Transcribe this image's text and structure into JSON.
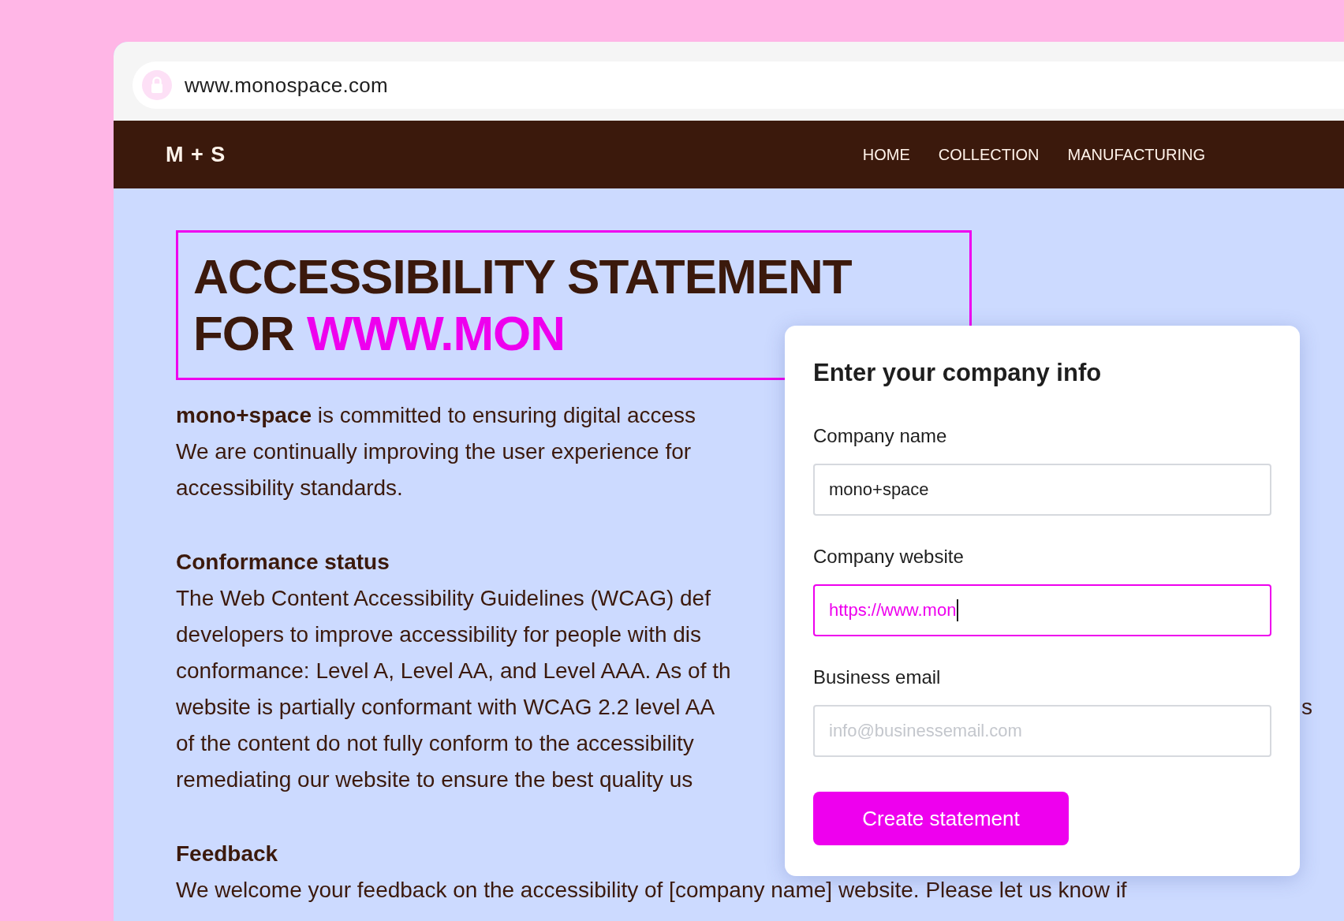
{
  "browser": {
    "url": "www.monospace.com"
  },
  "nav": {
    "logo": "M + S",
    "items": [
      {
        "label": "HOME"
      },
      {
        "label": "COLLECTION"
      },
      {
        "label": "MANUFACTURING"
      }
    ]
  },
  "heading": {
    "line_1": "ACCESSIBILITY STATEMENT",
    "line_2_prefix": "FOR",
    "line_2_highlight": "WWW.MON"
  },
  "intro": {
    "lines": [
      "**mono+space** is committed to ensuring digital access",
      "We are continually improving the user experience for",
      "accessibility standards."
    ]
  },
  "sections": [
    {
      "title": "Conformance status",
      "lines": [
        {
          "text": "The Web Content Accessibility Guidelines (WCAG) def"
        },
        {
          "text": "developers to improve accessibility for people with dis"
        },
        {
          "text": "conformance: Level A, Level AA, and Level AAA. As of th"
        },
        {
          "text": "website is partially conformant with WCAG 2.2 level AA",
          "tail": "s"
        },
        {
          "text": "of the content do not fully conform to the accessibility"
        },
        {
          "text": "remediating our website to ensure the best quality us"
        }
      ]
    },
    {
      "title": "Feedback",
      "lines": [
        {
          "text": "We welcome your feedback on the accessibility of [company name] website. Please let us know if"
        }
      ]
    }
  ],
  "form": {
    "title": "Enter your company info",
    "fields": [
      {
        "label": "Company name",
        "value": "mono+space",
        "focused": false
      },
      {
        "label": "Company website",
        "value": "https://www.mon",
        "focused": true
      },
      {
        "label": "Business email",
        "placeholder": "info@businessemail.com",
        "focused": false
      }
    ],
    "button": "Create statement"
  }
}
